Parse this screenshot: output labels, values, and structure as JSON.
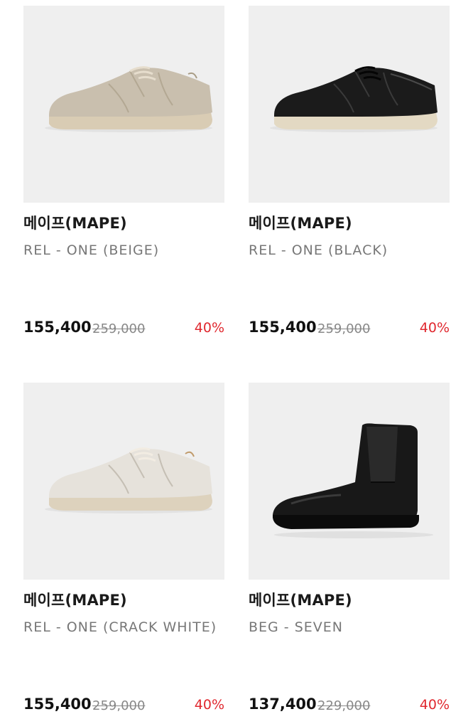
{
  "products": [
    {
      "brand": "메이프(MAPE)",
      "name": "REL - ONE (BEIGE)",
      "price": "155,400",
      "original_price": "259,000",
      "discount": "40%",
      "image_icon": "beige-sneaker-image"
    },
    {
      "brand": "메이프(MAPE)",
      "name": "REL - ONE (BLACK)",
      "price": "155,400",
      "original_price": "259,000",
      "discount": "40%",
      "image_icon": "black-sneaker-image"
    },
    {
      "brand": "메이프(MAPE)",
      "name": "REL - ONE (CRACK WHITE)",
      "price": "155,400",
      "original_price": "259,000",
      "discount": "40%",
      "image_icon": "white-sneaker-image"
    },
    {
      "brand": "메이프(MAPE)",
      "name": "BEG - SEVEN",
      "price": "137,400",
      "original_price": "229,000",
      "discount": "40%",
      "image_icon": "black-chelsea-boot-image"
    }
  ],
  "colors": {
    "discount": "#e0282f",
    "image_bg": "#efefef"
  }
}
